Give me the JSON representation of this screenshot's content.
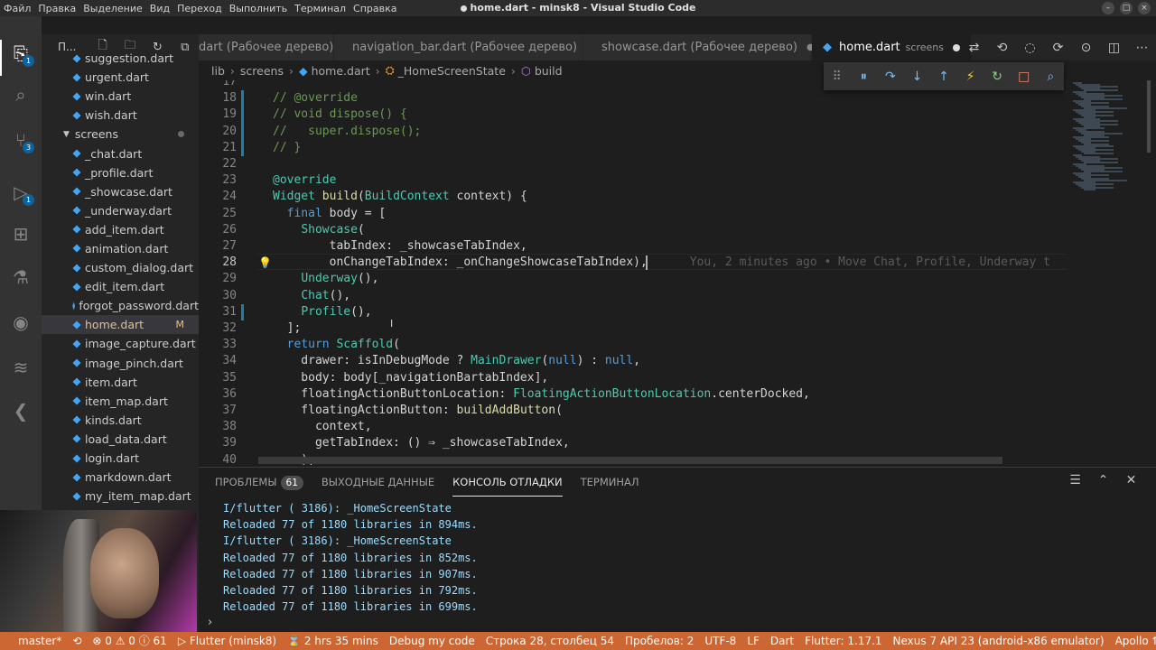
{
  "window": {
    "title": "home.dart - minsk8 - Visual Studio Code",
    "menu": [
      "Файл",
      "Правка",
      "Выделение",
      "Вид",
      "Переход",
      "Выполнить",
      "Терминал",
      "Справка"
    ]
  },
  "activity": {
    "items": [
      {
        "name": "explorer-icon",
        "glyph": "⎘",
        "badge": "1"
      },
      {
        "name": "search-icon",
        "glyph": "⌕",
        "badge": ""
      },
      {
        "name": "source-control-icon",
        "glyph": "⑂",
        "badge": "3"
      },
      {
        "name": "run-debug-icon",
        "glyph": "▷",
        "badge": "1"
      },
      {
        "name": "extensions-icon",
        "glyph": "⊞",
        "badge": ""
      },
      {
        "name": "testing-icon",
        "glyph": "⚗",
        "badge": ""
      },
      {
        "name": "git-graph-icon",
        "glyph": "◉",
        "badge": ""
      },
      {
        "name": "docker-icon",
        "glyph": "≋",
        "badge": ""
      },
      {
        "name": "gitlens-icon",
        "glyph": "❮",
        "badge": ""
      }
    ]
  },
  "sidebar": {
    "title": "П...",
    "files_top": [
      "suggestion.dart",
      "urgent.dart",
      "win.dart",
      "wish.dart"
    ],
    "folder": "screens",
    "files": [
      "_chat.dart",
      "_profile.dart",
      "_showcase.dart",
      "_underway.dart",
      "add_item.dart",
      "animation.dart",
      "custom_dialog.dart",
      "edit_item.dart",
      "forgot_password.dart",
      "home.dart",
      "image_capture.dart",
      "image_pinch.dart",
      "item.dart",
      "item_map.dart",
      "kinds.dart",
      "load_data.dart",
      "login.dart",
      "markdown.dart",
      "my_item_map.dart"
    ],
    "selected_file": "home.dart",
    "selected_badge": "M"
  },
  "tabs": [
    {
      "label": "dart (Рабочее дерево)",
      "active": false
    },
    {
      "label": "navigation_bar.dart (Рабочее дерево)",
      "active": false
    },
    {
      "label": "showcase.dart (Рабочее дерево)",
      "active": false
    },
    {
      "label": "home.dart",
      "sub": "screens",
      "active": true
    }
  ],
  "breadcrumb": [
    "lib",
    "screens",
    "home.dart",
    "_HomeScreenState",
    "build"
  ],
  "editor": {
    "lines": [
      {
        "n": "17",
        "html": ""
      },
      {
        "n": "18",
        "html": "<span class=\"cm\">// @override</span>"
      },
      {
        "n": "19",
        "html": "<span class=\"cm\">// void dispose() {</span>"
      },
      {
        "n": "20",
        "html": "<span class=\"cm\">//   super.dispose();</span>"
      },
      {
        "n": "21",
        "html": "<span class=\"cm\">// }</span>"
      },
      {
        "n": "22",
        "html": ""
      },
      {
        "n": "23",
        "html": "<span class=\"ty\">@override</span>"
      },
      {
        "n": "24",
        "html": "<span class=\"ty\">Widget</span> <span class=\"fn\">build</span>(<span class=\"ty\">BuildContext</span> context) {"
      },
      {
        "n": "25",
        "html": "  <span class=\"kw\">final</span> body = ["
      },
      {
        "n": "26",
        "html": "    <span class=\"ty\">Showcase</span>("
      },
      {
        "n": "27",
        "html": "        tabIndex: _showcaseTabIndex,"
      },
      {
        "n": "28",
        "html": "        onChangeTabIndex: _onChangeShowcaseTabIndex),      <span class=\"blame\">You, 2 minutes ago • Move Chat, Profile, Underway t</span>"
      },
      {
        "n": "29",
        "html": "    <span class=\"ty\">Underway</span>(),"
      },
      {
        "n": "30",
        "html": "    <span class=\"ty\">Chat</span>(),"
      },
      {
        "n": "31",
        "html": "    <span class=\"ty\">Profile</span>(),"
      },
      {
        "n": "32",
        "html": "  ];"
      },
      {
        "n": "33",
        "html": "  <span class=\"kw\">return</span> <span class=\"ty\">Scaffold</span>("
      },
      {
        "n": "34",
        "html": "    drawer: isInDebugMode ? <span class=\"ty\">MainDrawer</span>(<span class=\"nl\">null</span>) : <span class=\"nl\">null</span>,"
      },
      {
        "n": "35",
        "html": "    body: body[_navigationBartabIndex],"
      },
      {
        "n": "36",
        "html": "    floatingActionButtonLocation: <span class=\"ty\">FloatingActionButtonLocation</span>.centerDocked,"
      },
      {
        "n": "37",
        "html": "    floatingActionButton: <span class=\"fn\">buildAddButton</span>("
      },
      {
        "n": "38",
        "html": "      context,"
      },
      {
        "n": "39",
        "html": "      getTabIndex: () ⇒ _showcaseTabIndex,"
      },
      {
        "n": "40",
        "html": "    ),"
      }
    ]
  },
  "panel": {
    "tabs": [
      {
        "label": "ПРОБЛЕМЫ",
        "count": "61",
        "active": false
      },
      {
        "label": "ВЫХОДНЫЕ ДАННЫЕ",
        "count": "",
        "active": false
      },
      {
        "label": "КОНСОЛЬ ОТЛАДКИ",
        "count": "",
        "active": true
      },
      {
        "label": "ТЕРМИНАЛ",
        "count": "",
        "active": false
      }
    ],
    "output": [
      "I/flutter ( 3186): _HomeScreenState",
      "Reloaded 77 of 1180 libraries in 894ms.",
      "I/flutter ( 3186): _HomeScreenState",
      "Reloaded 77 of 1180 libraries in 852ms.",
      "Reloaded 77 of 1180 libraries in 907ms.",
      "Reloaded 77 of 1180 libraries in 792ms.",
      "Reloaded 77 of 1180 libraries in 699ms."
    ]
  },
  "status": {
    "branch": "master*",
    "sync": "⟲",
    "errors": "⊗ 0 ⚠ 0 ⓘ 61",
    "flutter_run": "▷ Flutter (minsk8)",
    "time": "⌛ 2 hrs 35 mins",
    "debug": "Debug my code",
    "position": "Строка 28, столбец 54",
    "spaces": "Пробелов: 2",
    "encoding": "UTF-8",
    "eol": "LF",
    "language": "Dart",
    "flutter_version": "Flutter: 1.17.1",
    "device": "Nexus 7 API 23 (android-x86 emulator)",
    "apollo": "Apollo ⇅",
    "bell": "🔔"
  },
  "colors": {
    "status_bar": "#cc6633",
    "accent": "#0e639c"
  }
}
